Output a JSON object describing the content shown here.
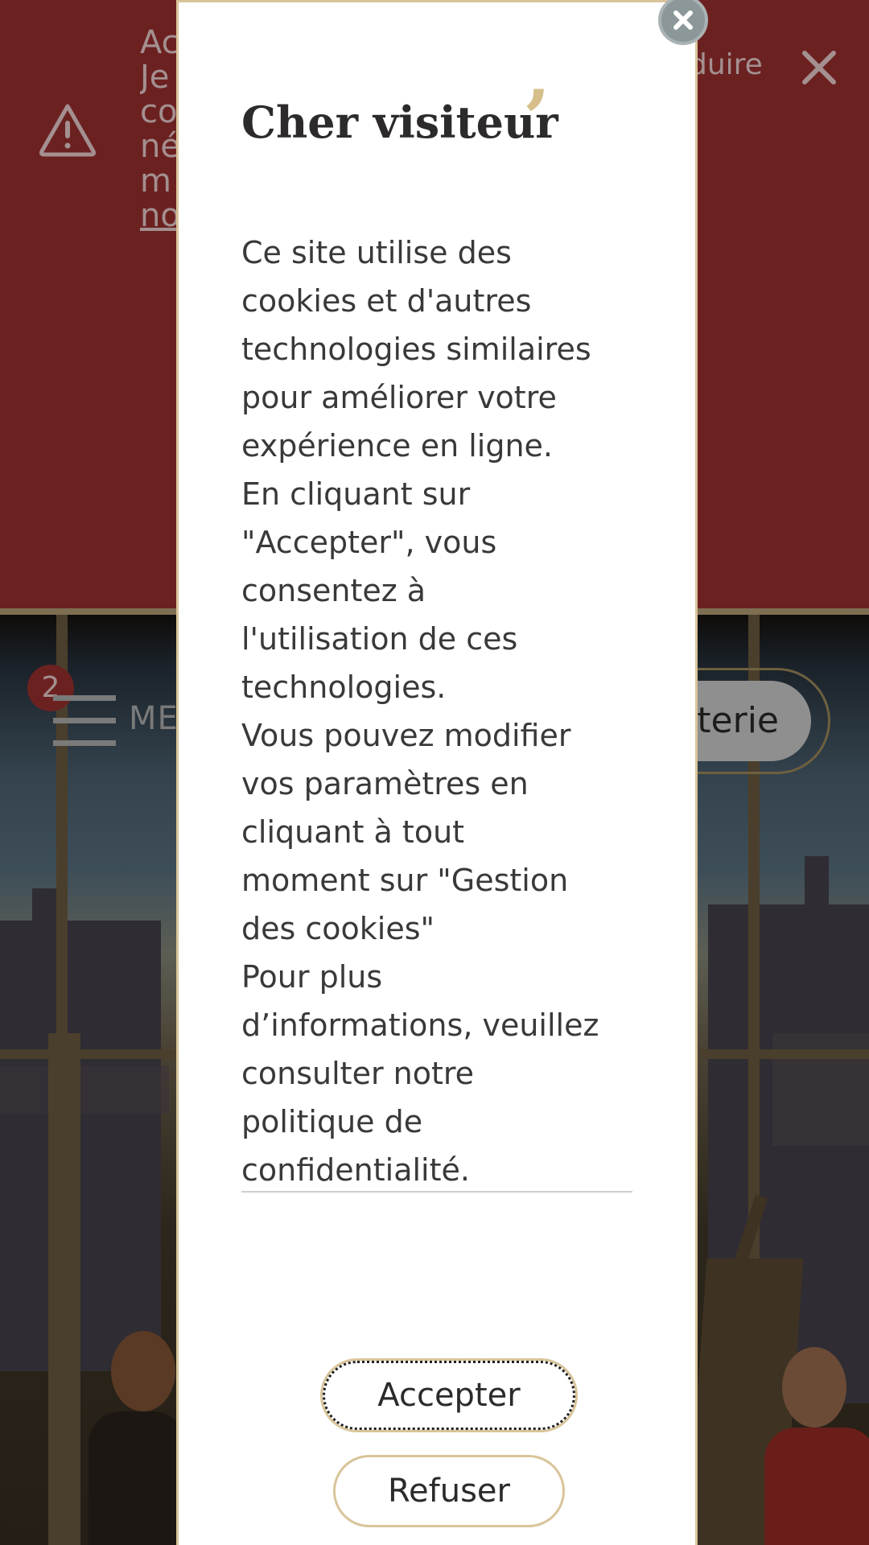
{
  "alert_banner": {
    "text_lines": [
      "Ac",
      "Je",
      "co",
      "né",
      "m"
    ],
    "link_text": "no",
    "more_text": "duire",
    "icon": "warning-triangle-icon",
    "close_icon": "close-icon"
  },
  "header": {
    "badge_count": "2",
    "menu_label": "ME",
    "billetterie_label": "terie"
  },
  "modal": {
    "title": "Cher visiteur",
    "title_mark": "’",
    "body": "Ce site utilise des\ncookies et d'autres\ntechnologies similaires\npour améliorer votre\nexpérience en ligne.\nEn cliquant sur\n\"Accepter\", vous\nconsentez à\nl'utilisation de ces\ntechnologies.\nVous pouvez modifier\nvos paramètres en\ncliquant à tout\nmoment sur \"Gestion\ndes cookies\"\nPour plus\nd’informations, veuillez\nconsulter notre\npolitique de\nconfidentialité.",
    "accept_label": "Accepter",
    "refuse_label": "Refuser",
    "close_icon": "close-icon"
  },
  "colors": {
    "banner": "#6c2121",
    "accent_gold": "#d9c49a",
    "modal_bg": "#ffffff",
    "text": "#3a3838"
  }
}
